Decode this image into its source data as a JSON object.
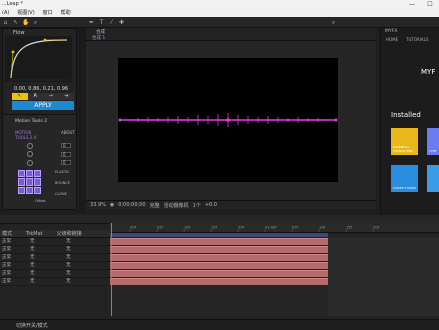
{
  "window": {
    "title": "...Leap *",
    "minimize": "—",
    "maximize": "☐"
  },
  "menu": {
    "items": [
      "(A)",
      "视图(V)",
      "窗口",
      "帮助"
    ]
  },
  "flow": {
    "tab": "Flow",
    "values": "0.00, 0.86, 0.21, 0.96",
    "tools": [
      "↖",
      "A",
      "→",
      "⇥"
    ],
    "apply": "APPLY"
  },
  "motion": {
    "tab": "Motion Tools 2",
    "logo": "MOTION TOOLS 2.X",
    "about": "ABOUT",
    "inputs": [
      "0",
      "0",
      "0"
    ],
    "options": [
      "ELASTIC",
      "BOUNCE",
      "CLONE"
    ],
    "offset": "Offset"
  },
  "comp": {
    "tab": "合成",
    "name": "合成 1",
    "zoom": "33.9%",
    "timecode": "0;00;00;00",
    "resolution": "完整",
    "camera": "活动摄像机",
    "views": "1个",
    "value": "+0.0"
  },
  "brand": {
    "tab": "MYFX",
    "subtabs": [
      "HOME",
      "TUTORIALS"
    ],
    "logo": "MYF"
  },
  "installed": {
    "heading": "Installed",
    "plugins": [
      {
        "label": "ESSENTIAL TRANSITIONS"
      },
      {
        "label": "LOWER THIRDS"
      },
      {
        "label": "TYPE"
      }
    ]
  },
  "timeline": {
    "columns": [
      "模式",
      "TrkMat",
      "父级和链接"
    ],
    "mode": "正常",
    "none": "无",
    "rulerTicks": [
      "00f",
      "05f",
      "10f",
      "15f",
      "20f",
      "01:00f",
      "05f",
      "10f",
      "15f",
      "20f"
    ],
    "status": "切换开关/模式"
  },
  "colors": {
    "accent": "#1c8ad1",
    "wave": "#e040e0",
    "purple": "#7a5ad8",
    "bar": "#b36b6b",
    "playhead": "#4a8cff",
    "gold": "#e8c700"
  }
}
